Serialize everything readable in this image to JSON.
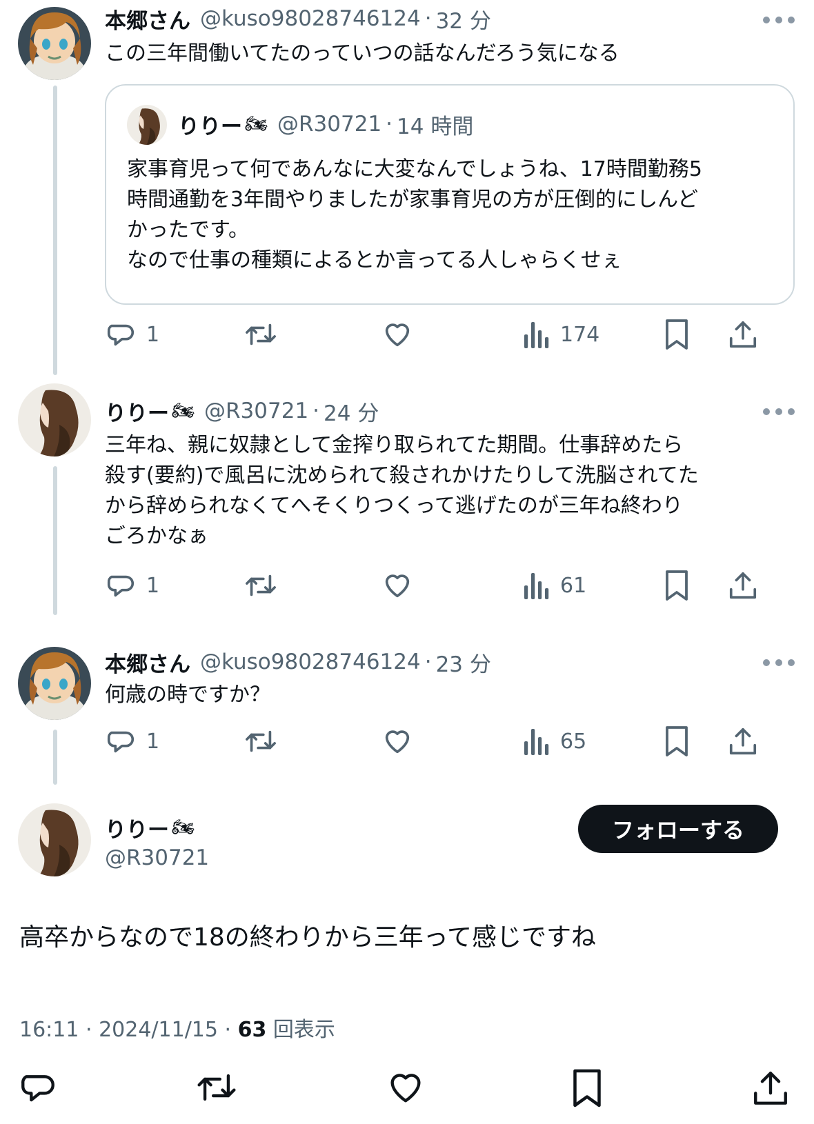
{
  "posts": [
    {
      "name": "本郷さん",
      "handle": "@kuso98028746124",
      "time": "32 分",
      "text": [
        "この三年間働いてたのっていつの話なんだろう気になる"
      ],
      "quote": {
        "name": "りりー",
        "bike": "🏍",
        "handle": "@R30721",
        "time": "14 時間",
        "text": [
          "家事育児って何であんなに大変なんでしょうね、17時間勤務5",
          "時間通勤を3年間やりましたが家事育児の方が圧倒的にしんど",
          "かったです。",
          "なので仕事の種類によるとか言ってる人しゃらくせぇ"
        ]
      },
      "replies": "1",
      "views": "174"
    },
    {
      "name": "りりー",
      "bike": "🏍",
      "handle": "@R30721",
      "time": "24 分",
      "text": [
        "三年ね、親に奴隷として金搾り取られてた期間。仕事辞めたら",
        "殺す(要約)で風呂に沈められて殺されかけたりして洗脳されてた",
        "から辞められなくてへそくりつくって逃げたのが三年ね終わり",
        "ごろかなぁ"
      ],
      "replies": "1",
      "views": "61"
    },
    {
      "name": "本郷さん",
      "handle": "@kuso98028746124",
      "time": "23 分",
      "text": [
        "何歳の時ですか？"
      ],
      "replies": "1",
      "views": "65"
    }
  ],
  "main": {
    "name": "りりー",
    "bike": "🏍",
    "handle": "@R30721",
    "follow_label": "フォローする",
    "text": "高卒からなので18の終わりから三年って感じですね",
    "time": "16:11 · 2024/11/15 · ",
    "views": "63",
    "views_suffix": " 回表示"
  },
  "icons": {
    "reply": "reply-bubble-icon",
    "retweet": "retweet-arrows-icon",
    "like": "heart-icon",
    "views": "bar-chart-icon",
    "bookmark": "bookmark-icon",
    "share": "share-upload-icon",
    "more": "ellipsis-icon"
  },
  "colors": {
    "text": "#0f1419",
    "secondary": "#536471",
    "thread_line": "#cfd9de",
    "button_bg": "#0f1419"
  }
}
